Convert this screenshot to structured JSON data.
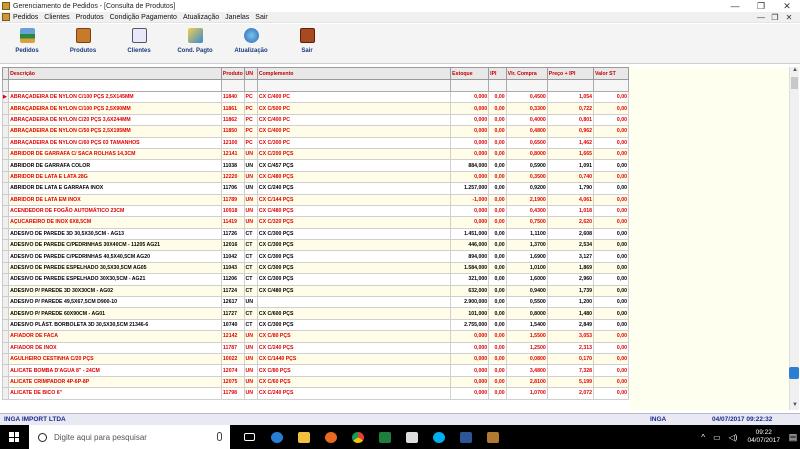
{
  "window": {
    "title": "Gerenciamento de Pedidos - [Consulta de Produtos]"
  },
  "menu": {
    "items": [
      "Pedidos",
      "Clientes",
      "Produtos",
      "Condição Pagamento",
      "Atualização",
      "Janelas",
      "Sair"
    ]
  },
  "toolbar": {
    "buttons": [
      {
        "label": "Pedidos",
        "icon": "pedidos-icon"
      },
      {
        "label": "Produtos",
        "icon": "produtos-icon"
      },
      {
        "label": "Clientes",
        "icon": "clientes-icon"
      },
      {
        "label": "Cond. Pagto",
        "icon": "cond-pagto-icon"
      },
      {
        "label": "Atualização",
        "icon": "atualizacao-icon"
      },
      {
        "label": "Sair",
        "icon": "sair-icon"
      }
    ]
  },
  "table": {
    "columns": [
      "Descrição",
      "Produto",
      "UN",
      "Complemento",
      "Estoque",
      "IPI",
      "Vlr. Compra",
      "Preço + IPI",
      "Valor ST"
    ],
    "rows": [
      [
        "ABRAÇADEIRA DE NYLON C/100 PÇS 2,5X145MM",
        "11840",
        "PC",
        "CX C/400 PC",
        "0,000",
        "0,00",
        "0,4500",
        "1,054",
        "0,00",
        "red"
      ],
      [
        "ABRAÇADEIRA DE NYLON C/100 PÇS 2,5X90MM",
        "11861",
        "PC",
        "CX C/500 PC",
        "0,000",
        "0,00",
        "0,3300",
        "0,722",
        "0,00",
        "red"
      ],
      [
        "ABRAÇADEIRA DE NYLON C/20 PÇS 3,6X244MM",
        "11862",
        "PC",
        "CX C/400 PC",
        "0,000",
        "0,00",
        "0,4000",
        "0,801",
        "0,00",
        "red"
      ],
      [
        "ABRAÇADEIRA DE NYLON C/50 PÇS 2,5X195MM",
        "11850",
        "PC",
        "CX C/400 PC",
        "0,000",
        "0,00",
        "0,4800",
        "0,962",
        "0,00",
        "red"
      ],
      [
        "ABRAÇADEIRA DE NYLON C/60 PÇS 03 TAMANHOS",
        "12100",
        "PC",
        "CX C/300 PC",
        "0,000",
        "0,00",
        "0,6500",
        "1,462",
        "0,00",
        "red"
      ],
      [
        "ABRIDOR DE GARRAFA C/ SACA ROLHAS 14,3CM",
        "12141",
        "UN",
        "CX C/200 PÇS",
        "0,000",
        "0,00",
        "0,8000",
        "1,665",
        "0,00",
        "red"
      ],
      [
        "ABRIDOR DE GARRAFA COLOR",
        "11038",
        "UN",
        "CX C/457 PÇS",
        "884,000",
        "0,00",
        "0,5900",
        "1,091",
        "0,00",
        "blk"
      ],
      [
        "ABRIDOR DE LATA E LATA 28G",
        "12220",
        "UN",
        "CX C/480 PÇS",
        "0,000",
        "0,00",
        "0,3500",
        "0,740",
        "0,00",
        "red"
      ],
      [
        "ABRIDOR DE LATA E GARRAFA INOX",
        "11706",
        "UN",
        "CX C/240 PÇS",
        "1.257,000",
        "0,00",
        "0,9200",
        "1,790",
        "0,00",
        "blk"
      ],
      [
        "ABRIDOR DE LATA EM INOX",
        "11789",
        "UN",
        "CX C/144 PÇS",
        "-1,000",
        "0,00",
        "2,1900",
        "4,061",
        "0,00",
        "red"
      ],
      [
        "ACENDEDOR DE FOGÃO AUTOMÁTICO 23CM",
        "10918",
        "UN",
        "CX C/480 PÇS",
        "0,000",
        "0,00",
        "0,4300",
        "1,018",
        "0,00",
        "red"
      ],
      [
        "AÇUCAREIRO DE INOX 6X8,5CM",
        "11419",
        "UN",
        "CX C/320 PÇS",
        "0,000",
        "0,00",
        "0,7500",
        "2,620",
        "0,00",
        "red"
      ],
      [
        "ADESIVO DE PAREDE 3D 30,5X30,5CM - AG13",
        "11726",
        "CT",
        "CX C/300 PÇS",
        "1.451,000",
        "0,00",
        "1,1100",
        "2,608",
        "0,00",
        "blk"
      ],
      [
        "ADESIVO DE PAREDE C/PEDRINHAS 30X40CM - 11205 AG21",
        "12016",
        "CT",
        "CX C/300 PÇS",
        "446,000",
        "0,00",
        "1,3700",
        "2,534",
        "0,00",
        "blk"
      ],
      [
        "ADESIVO DE PAREDE C/PEDRINHAS 40,5X40,5CM AG20",
        "11042",
        "CT",
        "CX C/300 PÇS",
        "894,000",
        "0,00",
        "1,6900",
        "3,127",
        "0,00",
        "blk"
      ],
      [
        "ADESIVO DE PAREDE ESPELHADO 30,5X30,5CM AG05",
        "11043",
        "CT",
        "CX C/300 PÇS",
        "1.584,000",
        "0,00",
        "1,0100",
        "1,869",
        "0,00",
        "blk"
      ],
      [
        "ADESIVO DE PAREDE ESPELHADO 30X30,5CM - AG21",
        "11206",
        "CT",
        "CX C/300 PÇS",
        "321,000",
        "0,00",
        "1,6000",
        "2,960",
        "0,00",
        "blk"
      ],
      [
        "ADESIVO P/ PAREDE 3D 30X30CM - AG02",
        "11724",
        "CT",
        "CX C/480 PÇS",
        "632,000",
        "0,00",
        "0,9400",
        "1,739",
        "0,00",
        "blk"
      ],
      [
        "ADESIVO P/ PAREDE 49,5X67,5CM D900-10",
        "12617",
        "UN",
        "",
        "2.900,000",
        "0,00",
        "0,5500",
        "1,200",
        "0,00",
        "blk"
      ],
      [
        "ADESIVO P/ PAREDE 60X90CM - AG01",
        "11727",
        "CT",
        "CX C/600 PÇS",
        "101,000",
        "0,00",
        "0,8000",
        "1,480",
        "0,00",
        "blk"
      ],
      [
        "ADESIVO PLÁST. BORBOLETA 3D 30,5X30,5CM 21346-6",
        "10740",
        "CT",
        "CX C/300 PÇS",
        "2.755,000",
        "0,00",
        "1,5400",
        "2,849",
        "0,00",
        "blk"
      ],
      [
        "AFIADOR DE FACA",
        "12142",
        "UN",
        "CX C/80 PÇS",
        "0,000",
        "0,00",
        "1,5500",
        "3,053",
        "0,00",
        "red"
      ],
      [
        "AFIADOR DE INOX",
        "11787",
        "UN",
        "CX C/240 PÇS",
        "0,000",
        "0,00",
        "1,2500",
        "2,313",
        "0,00",
        "red"
      ],
      [
        "AGULHEIRO CESTINHA C/20 PÇS",
        "10022",
        "UN",
        "CX C/1440 PÇS",
        "0,000",
        "0,00",
        "0,0800",
        "0,170",
        "0,00",
        "red"
      ],
      [
        "ALICATE BOMBA D'AGUA 8\" - 24CM",
        "12074",
        "UN",
        "CX C/80 PÇS",
        "0,000",
        "0,00",
        "3,4800",
        "7,328",
        "0,00",
        "red"
      ],
      [
        "ALICATE CRIMPADOR 4P-6P-8P",
        "12075",
        "UN",
        "CX C/60 PÇS",
        "0,000",
        "0,00",
        "2,8100",
        "5,199",
        "0,00",
        "red"
      ],
      [
        "ALICATE DE BICO 6\"",
        "11798",
        "UN",
        "CX C/240 PÇS",
        "0,000",
        "0,00",
        "1,0700",
        "2,072",
        "0,00",
        "red"
      ]
    ]
  },
  "status": {
    "left": "INGA IMPORT LTDA",
    "middle": "INGA",
    "datetime": "04/07/2017 09:22:32"
  },
  "taskbar": {
    "search_placeholder": "Digite aqui para pesquisar",
    "time": "09:22",
    "date": "04/07/2017",
    "app_icons": [
      "task-view-icon",
      "edge-icon",
      "file-explorer-icon",
      "firefox-icon",
      "chrome-icon",
      "calculator-icon",
      "app-icon",
      "skype-icon",
      "word-icon",
      "app-window-icon"
    ]
  },
  "colors": {
    "red_text": "#e00000",
    "header_text": "#c00000",
    "status_text": "#1a2a8a",
    "row_alt": "#fffde8"
  }
}
